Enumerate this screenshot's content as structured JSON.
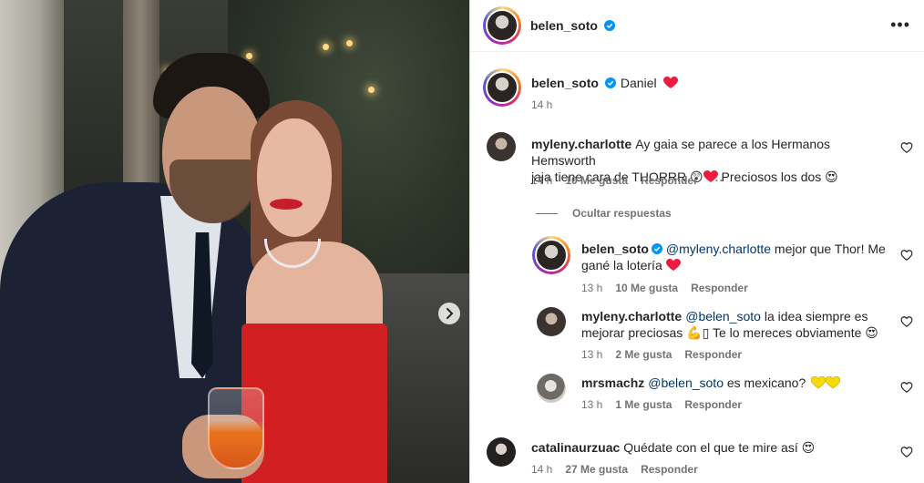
{
  "post": {
    "author": "belen_soto",
    "caption": "Daniel",
    "caption_time": "14 h",
    "more_label": "•••"
  },
  "comments": [
    {
      "user": "myleny.charlotte",
      "text_part1": "Ay gaia se parece a los Hermanos Hemsworth",
      "text_part2": "jaja tiene cara de THORRR",
      "text_part3": "Preciosos los dos",
      "time": "14 h",
      "likes": "10 Me gusta",
      "reply": "Responder",
      "replies_toggle": "Ocultar respuestas",
      "replies": [
        {
          "user": "belen_soto",
          "mention": "@myleny.charlotte",
          "text_part1": "mejor que Thor! Me",
          "text_part2": "gané la lotería",
          "time": "13 h",
          "likes": "10 Me gusta",
          "reply": "Responder"
        },
        {
          "user": "myleny.charlotte",
          "mention": "@belen_soto",
          "text_part1": "la idea siempre es",
          "text_part2": "mejorar preciosas",
          "text_part3": "Te lo mereces obviamente",
          "time": "13 h",
          "likes": "2 Me gusta",
          "reply": "Responder"
        },
        {
          "user": "mrsmachz",
          "mention": "@belen_soto",
          "text_part1": "es mexicano?",
          "time": "13 h",
          "likes": "1 Me gusta",
          "reply": "Responder"
        }
      ]
    },
    {
      "user": "catalinaurzuac",
      "text_part1": "Quédate con el que te mire así",
      "time": "14 h",
      "likes": "27 Me gusta",
      "reply": "Responder"
    }
  ],
  "icons": {
    "verified": "verified-badge-icon",
    "heart": "heart-outline-icon",
    "next": "chevron-right-icon"
  },
  "colors": {
    "verified": "#0095f6",
    "red_heart": "#ed1b3f",
    "yellow_heart": "#f5d90a",
    "mention": "#00376b",
    "muted": "#737373"
  }
}
